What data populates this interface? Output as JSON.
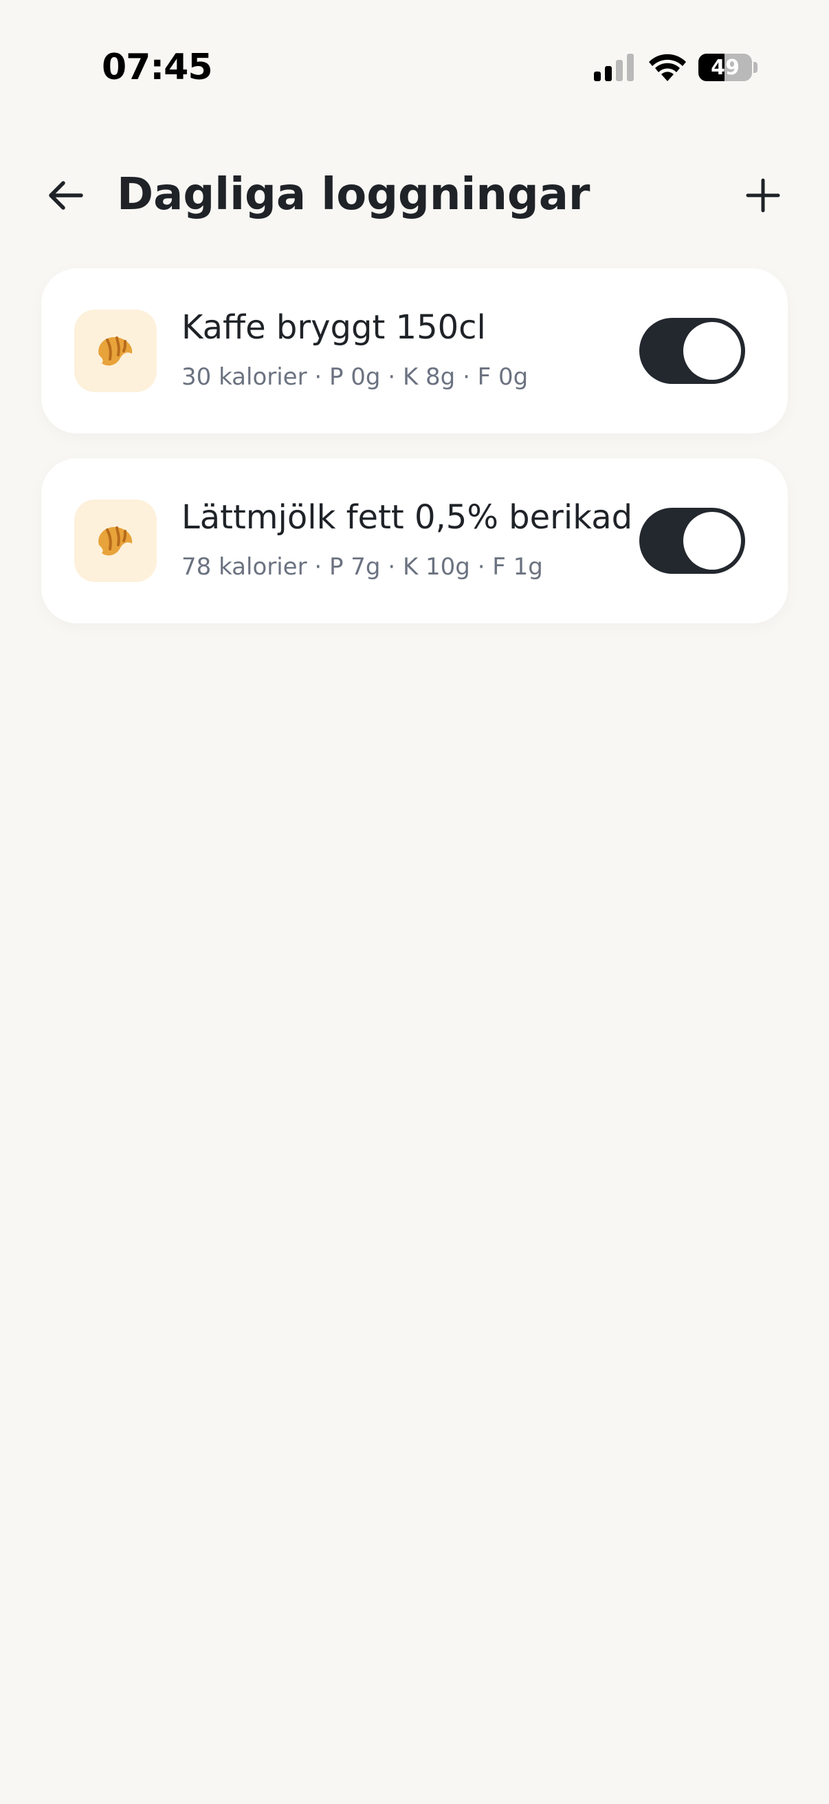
{
  "status_bar": {
    "time": "07:45",
    "battery_level": "49",
    "battery_fraction": 0.49
  },
  "header": {
    "title": "Dagliga loggningar",
    "back_icon": "arrow-left-icon",
    "add_icon": "plus-icon"
  },
  "logs": [
    {
      "name": "Kaffe bryggt 150cl",
      "macros": "30 kalorier · P 0g · K 8g · F 0g",
      "icon": "croissant-icon",
      "enabled": true
    },
    {
      "name": "Lättmjölk fett 0,5% berikad",
      "macros": "78 kalorier · P 7g · K 10g · F 1g",
      "icon": "croissant-icon",
      "enabled": true
    }
  ],
  "colors": {
    "background": "#f8f7f3",
    "card": "#ffffff",
    "icon_tile": "#fdf1dc",
    "toggle_on": "#23272e",
    "text_primary": "#1f2328",
    "text_secondary": "#6b7280"
  }
}
